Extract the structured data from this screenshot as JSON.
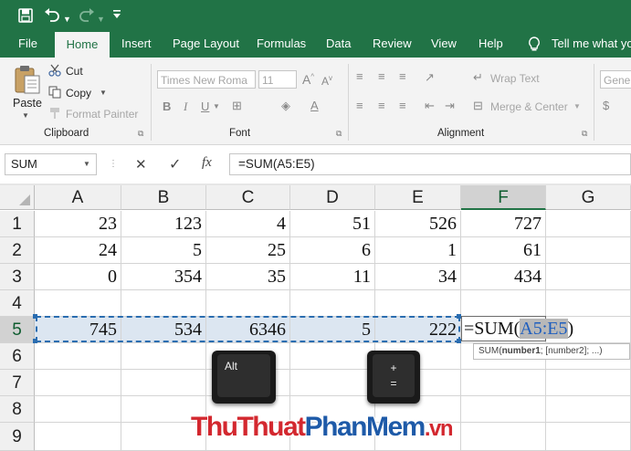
{
  "title_bar": {
    "save_icon": "save-icon",
    "undo_icon": "undo-icon",
    "redo_icon": "redo-icon",
    "customize_icon": "chevron-down-icon"
  },
  "tabs": [
    "File",
    "Home",
    "Insert",
    "Page Layout",
    "Formulas",
    "Data",
    "Review",
    "View",
    "Help"
  ],
  "active_tab": "Home",
  "tell_me": "Tell me what you",
  "ribbon": {
    "clipboard": {
      "paste": "Paste",
      "cut": "Cut",
      "copy": "Copy",
      "format_painter": "Format Painter",
      "label": "Clipboard"
    },
    "font": {
      "font_name": "Times New Roma",
      "font_size": "11",
      "label": "Font"
    },
    "alignment": {
      "wrap_text": "Wrap Text",
      "merge_center": "Merge & Center",
      "label": "Alignment"
    },
    "number": {
      "format": "Gene"
    }
  },
  "formula_bar": {
    "name_box": "SUM",
    "cancel": "✕",
    "enter": "✓",
    "fx": "fx",
    "formula": "=SUM(A5:E5)"
  },
  "columns": [
    "A",
    "B",
    "C",
    "D",
    "E",
    "F",
    "G"
  ],
  "rows": [
    {
      "num": "1",
      "cells": [
        "23",
        "123",
        "4",
        "51",
        "526",
        "727",
        ""
      ]
    },
    {
      "num": "2",
      "cells": [
        "24",
        "5",
        "25",
        "6",
        "1",
        "61",
        ""
      ]
    },
    {
      "num": "3",
      "cells": [
        "0",
        "354",
        "35",
        "11",
        "34",
        "434",
        ""
      ]
    },
    {
      "num": "4",
      "cells": [
        "",
        "",
        "",
        "",
        "",
        "",
        ""
      ]
    },
    {
      "num": "5",
      "cells": [
        "745",
        "534",
        "6346",
        "5",
        "222",
        "",
        ""
      ]
    },
    {
      "num": "6",
      "cells": [
        "",
        "",
        "",
        "",
        "",
        "",
        ""
      ]
    },
    {
      "num": "7",
      "cells": [
        "",
        "",
        "",
        "",
        "",
        "",
        ""
      ]
    },
    {
      "num": "8",
      "cells": [
        "",
        "",
        "",
        "",
        "",
        "",
        ""
      ]
    },
    {
      "num": "9",
      "cells": [
        "",
        "",
        "",
        "",
        "",
        "",
        ""
      ]
    }
  ],
  "active_cell": {
    "prefix": "=SUM(",
    "range": "A5:E5",
    "suffix": ")"
  },
  "tooltip": {
    "func": "SUM(",
    "arg1": "number1",
    "rest": "; [number2]; ...)"
  },
  "keys": {
    "alt": "Alt",
    "plus": "+",
    "equals": "="
  },
  "watermark": {
    "part1": "ThuThuat",
    "part2": "PhanMem",
    "part3": ".vn"
  },
  "colors": {
    "excel_green": "#217346",
    "selection_fill": "#dce6f1",
    "range_blue": "#1f5fbf",
    "watermark_red": "#d3282f",
    "watermark_blue": "#1e5aa8"
  }
}
